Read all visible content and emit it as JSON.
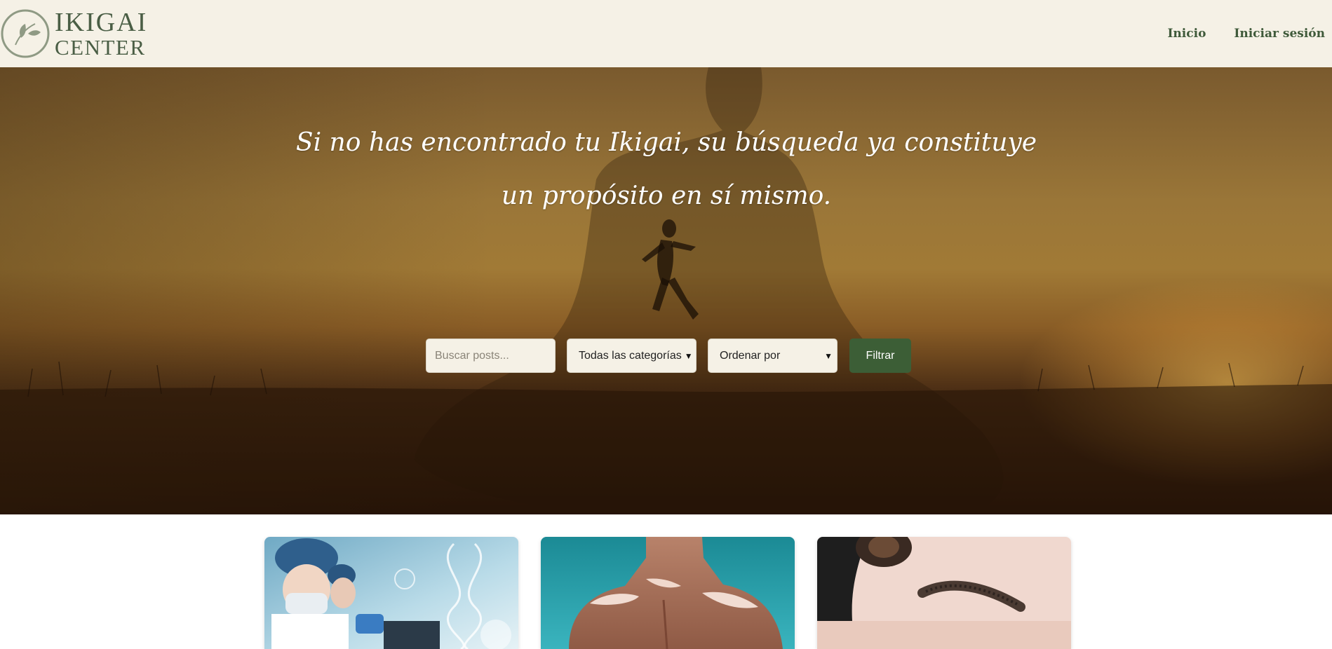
{
  "brand": {
    "line1": "IKIGAI",
    "line2": "CENTER",
    "logo_icon": "leaf-circle-icon"
  },
  "nav": {
    "items": [
      {
        "label": "Inicio"
      },
      {
        "label": "Iniciar sesión"
      }
    ]
  },
  "hero": {
    "quote": "Si no has encontrado tu Ikigai, su búsqueda ya constituye un propósito en sí mismo."
  },
  "filters": {
    "search": {
      "placeholder": "Buscar posts...",
      "value": ""
    },
    "category": {
      "selected": "Todas las categorías"
    },
    "order": {
      "selected": "Ordenar por"
    },
    "submit_label": "Filtrar"
  },
  "posts": [
    {
      "image": "scientists-dna-image"
    },
    {
      "image": "sunburned-back-image"
    },
    {
      "image": "microblading-eyebrow-image"
    }
  ],
  "colors": {
    "header_bg": "#f5f1e6",
    "brand_green": "#3c5e36",
    "nav_text": "#3f5a3a"
  }
}
